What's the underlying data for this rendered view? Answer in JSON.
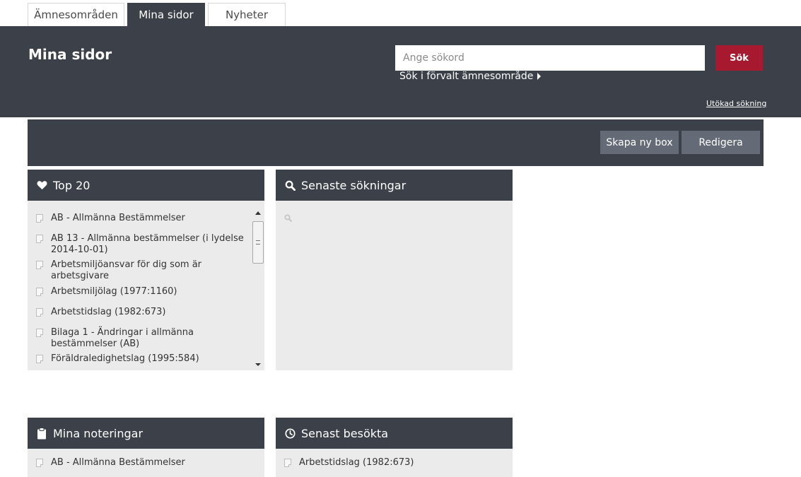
{
  "tabs": [
    {
      "label": "Ämnesområden",
      "active": false
    },
    {
      "label": "Mina sidor",
      "active": true
    },
    {
      "label": "Nyheter",
      "active": false
    }
  ],
  "header": {
    "title": "Mina sidor",
    "search": {
      "placeholder": "Ange sökord",
      "value": "",
      "button_label": "Sök"
    },
    "scope_link": "Sök i förvalt ämnesområde",
    "advanced_link": "Utökad sökning"
  },
  "toolbar": {
    "new_box_label": "Skapa ny box",
    "edit_label": "Redigera"
  },
  "panels": {
    "top20": {
      "title": "Top 20",
      "icon": "heart-icon",
      "items": [
        "AB - Allmänna Bestämmelser",
        "AB 13 - Allmänna bestämmelser (i lydelse 2014-10-01)",
        "Arbetsmiljöansvar för dig som är arbetsgivare",
        "Arbetsmiljölag (1977:1160)",
        "Arbetstidslag (1982:673)",
        "Bilaga 1 - Ändringar i allmänna bestämmelser (AB)",
        "Föräldraledighetslag (1995:584)"
      ]
    },
    "recent_searches": {
      "title": "Senaste sökningar",
      "icon": "search-icon"
    },
    "notes": {
      "title": "Mina noteringar",
      "icon": "clipboard-icon",
      "items": [
        "AB - Allmänna Bestämmelser"
      ]
    },
    "recently_visited": {
      "title": "Senast besökta",
      "icon": "clock-icon",
      "items": [
        "Arbetstidslag (1982:673)"
      ]
    }
  },
  "colors": {
    "header_bg": "#3b4049",
    "search_button": "#a6192e",
    "tool_button": "#646b76",
    "panel_body": "#ebebeb"
  }
}
